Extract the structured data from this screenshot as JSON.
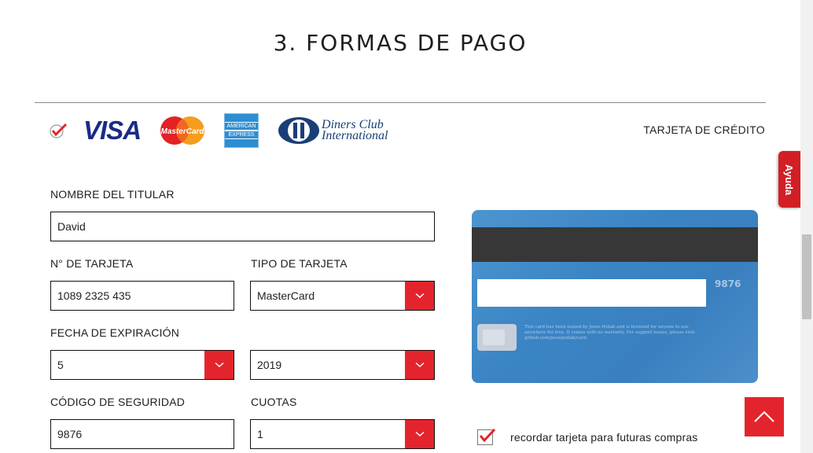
{
  "page": {
    "title": "3. FORMAS DE PAGO"
  },
  "payment_methods": {
    "card_type_label": "TARJETA DE CRÉDITO",
    "logos": {
      "visa": "VISA",
      "mastercard": "MasterCard",
      "amex_top": "AMERICAN",
      "amex_bottom": "EXPRESS",
      "diners_line1": "Diners Club",
      "diners_line2": "International"
    }
  },
  "form": {
    "holder_name": {
      "label": "NOMBRE DEL TITULAR",
      "value": "David"
    },
    "card_number": {
      "label": "N° DE TARJETA",
      "value": "1089 2325 435"
    },
    "card_type": {
      "label": "TIPO DE TARJETA",
      "value": "MasterCard"
    },
    "expiration": {
      "label": "FECHA DE EXPIRACIÓN",
      "month": "5",
      "year": "2019"
    },
    "security_code": {
      "label": "CÓDIGO DE SEGURIDAD",
      "value": "9876"
    },
    "installments": {
      "label": "CUOTAS",
      "value": "1"
    },
    "remember": {
      "label": "recordar tarjeta para futuras compras",
      "checked": true
    }
  },
  "card_preview": {
    "cvv": "9876",
    "fine_print": "This card has been issued by Jesse Pollak and is licensed for anyone to use anywhere for free. It comes with no warranty. For support issues, please visit: github.com/jessepollak/card."
  },
  "help_tab": {
    "label": "Ayuda"
  },
  "colors": {
    "accent": "#e4242c",
    "card_blue": "#3b85c5",
    "stripe": "#373737",
    "visa_blue": "#1a2a87"
  }
}
